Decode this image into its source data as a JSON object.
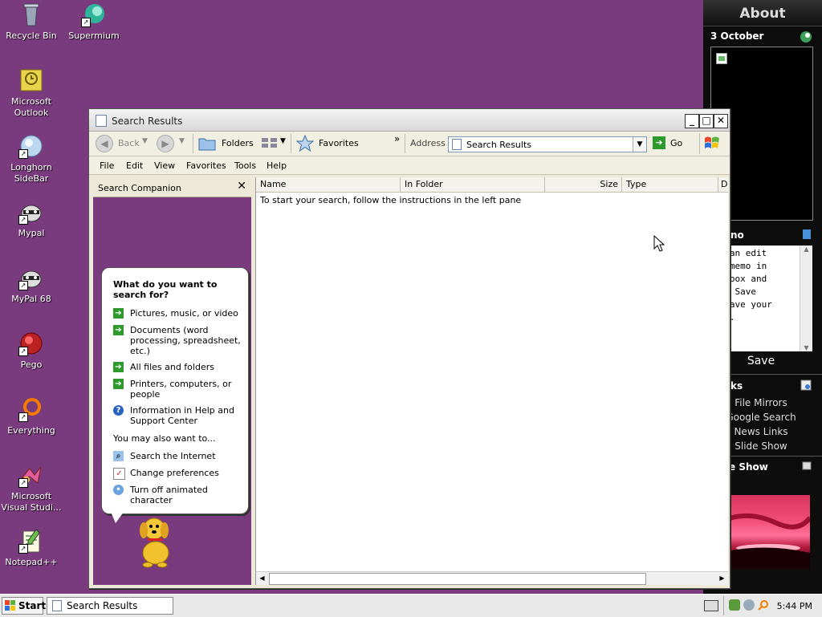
{
  "desktop": {
    "icons": [
      {
        "label": "Recycle Bin"
      },
      {
        "label": "Supermium"
      },
      {
        "label": "Microsoft Outlook"
      },
      {
        "label": "Longhorn SideBar"
      },
      {
        "label": "Mypal"
      },
      {
        "label": "MyPal 68"
      },
      {
        "label": "Pego"
      },
      {
        "label": "Everything"
      },
      {
        "label": "Microsoft Visual Studi..."
      },
      {
        "label": "Notepad++"
      }
    ]
  },
  "sidebar": {
    "header": "About",
    "calendar_date": "3 October",
    "memo_title": "no",
    "memo_text": "  can edit\n r memo in\n s box and\n ck Save\n  save your\n no.",
    "save_label": "Save",
    "links_title": "ks",
    "links": [
      "File Mirrors",
      "Google Search",
      "News Links",
      "Slide Show"
    ],
    "slideshow_title": "e Show"
  },
  "window": {
    "title": "Search Results",
    "toolbar": {
      "back": "Back",
      "folders": "Folders",
      "favorites": "Favorites",
      "address_label": "Address",
      "address_value": "Search Results",
      "go": "Go"
    },
    "menu": [
      "File",
      "Edit",
      "View",
      "Favorites",
      "Tools",
      "Help"
    ],
    "companion": {
      "title": "Search Companion",
      "question": "What do you want to search for?",
      "options": [
        "Pictures, music, or video",
        "Documents (word processing, spreadsheet, etc.)",
        "All files and folders",
        "Printers, computers, or people",
        "Information in Help and Support Center"
      ],
      "also_label": "You may also want to...",
      "extras": [
        "Search the Internet",
        "Change preferences",
        "Turn off animated character"
      ]
    },
    "columns": [
      "Name",
      "In Folder",
      "Size",
      "Type",
      "D"
    ],
    "hint": "To start your search, follow the instructions in the left pane"
  },
  "taskbar": {
    "start": "Start",
    "task": "Search Results",
    "clock": "5:44 PM"
  }
}
